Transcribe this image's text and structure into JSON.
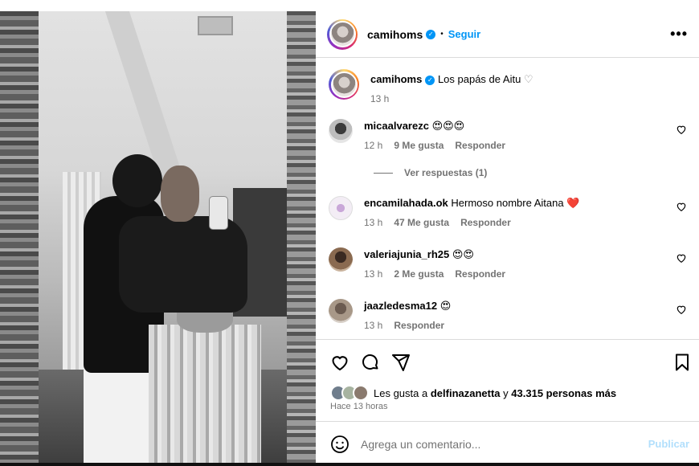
{
  "post": {
    "author": "camihoms",
    "follow_label": "Seguir",
    "more_label": "•••",
    "caption": "Los papás de Aitu",
    "caption_emoji": "♡",
    "caption_time": "13 h"
  },
  "comments": [
    {
      "user": "micaalvarezc",
      "text": "😍😍😍",
      "time": "12 h",
      "likes": "9 Me gusta",
      "reply": "Responder"
    },
    {
      "user": "encamilahada.ok",
      "text": "Hermoso nombre Aitana ❤️",
      "time": "13 h",
      "likes": "47 Me gusta",
      "reply": "Responder"
    },
    {
      "user": "valeriajunia_rh25",
      "text": "😍😍",
      "time": "13 h",
      "likes": "2 Me gusta",
      "reply": "Responder"
    },
    {
      "user": "jaazledesma12",
      "text": "😍",
      "time": "13 h",
      "likes": "",
      "reply": "Responder"
    }
  ],
  "view_replies": "Ver respuestas (1)",
  "likes": {
    "prefix": "Les gusta a",
    "user": "delfinazanetta",
    "middle": "y",
    "count": "43.315 personas más"
  },
  "posted_ago": "Hace 13 horas",
  "add_comment": {
    "placeholder": "Agrega un comentario...",
    "publish": "Publicar"
  },
  "icons": [
    "heart-icon",
    "comment-icon",
    "share-icon",
    "bookmark-icon",
    "emoji-icon",
    "verified-icon"
  ],
  "colors": {
    "accent": "#0095f6",
    "publish_disabled": "#b2dffc",
    "muted": "#737373"
  }
}
